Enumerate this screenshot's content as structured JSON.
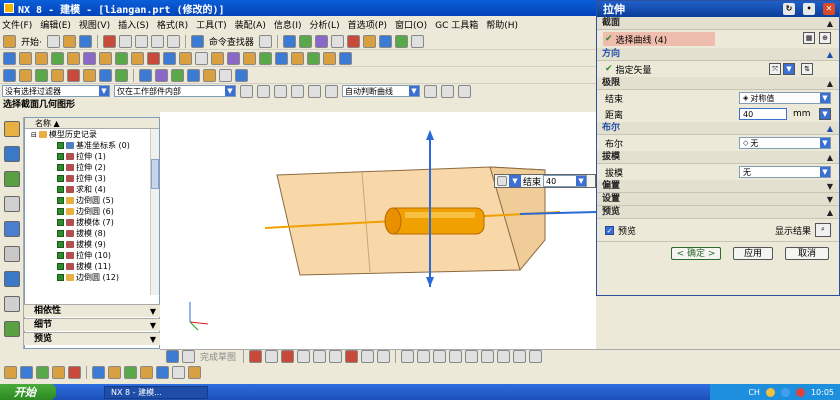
{
  "window": {
    "title": "NX 8 - 建模 - [liangan.prt  (修改的)]"
  },
  "menu": [
    "文件(F)",
    "编辑(E)",
    "视图(V)",
    "插入(S)",
    "格式(R)",
    "工具(T)",
    "装配(A)",
    "信息(I)",
    "分析(L)",
    "首选项(P)",
    "窗口(O)",
    "GC 工具箱",
    "帮助(H)"
  ],
  "toolbar": {
    "start_label": "开始·",
    "command_finder_label": "命令查找器"
  },
  "filter": {
    "type_filter": "没有选择过滤器",
    "scope": "仅在工作部件内部",
    "curve_rule": "自动判断曲线"
  },
  "cue_line": "选择截面几何图形",
  "navigator": {
    "header": "名称",
    "root": "模型历史记录",
    "items": [
      "基准坐标系 (0)",
      "拉伸 (1)",
      "拉伸 (2)",
      "拉伸 (3)",
      "求和 (4)",
      "边倒圆 (5)",
      "边倒圆 (6)",
      "拔模体 (7)",
      "拔模 (8)",
      "拔模 (9)",
      "拉伸 (10)",
      "拔模 (11)",
      "边倒圆 (12)"
    ],
    "sections": [
      "相依性",
      "细节",
      "预览"
    ]
  },
  "graphics": {
    "onscreen_end_label": "结束",
    "onscreen_value": "40"
  },
  "bottom_toolbar": {
    "sketch_label": "完成草图"
  },
  "dialog": {
    "title": "拉伸",
    "groups": {
      "section": "截面",
      "direction": "方向",
      "limits": "极限",
      "boolean": "布尔",
      "draft": "拔模",
      "offset": "偏置",
      "settings": "设置",
      "preview": "预览"
    },
    "select_curve": "选择曲线 (4)",
    "specify_vector": "指定矢量",
    "end_label": "结束",
    "end_value": "对称值",
    "distance_label": "距离",
    "distance_value": "40",
    "distance_unit": "mm",
    "boolean_label": "布尔",
    "boolean_value": "无",
    "draft_label": "拔模",
    "draft_value": "无",
    "preview_checkbox": "预览",
    "show_result": "显示结果",
    "ok": "< 确定 >",
    "apply": "应用",
    "cancel": "取消"
  },
  "taskbar": {
    "start": "开始",
    "task": "NX 8 - 建模...",
    "lang": "CH",
    "time": "10:05"
  },
  "colors": {
    "solid_face": "#f8d8a8",
    "solid_edge": "#8a6a40",
    "highlight": "#f0a000",
    "axis_blue": "#2a6ad8",
    "title_blue": "#0a5fd8"
  }
}
